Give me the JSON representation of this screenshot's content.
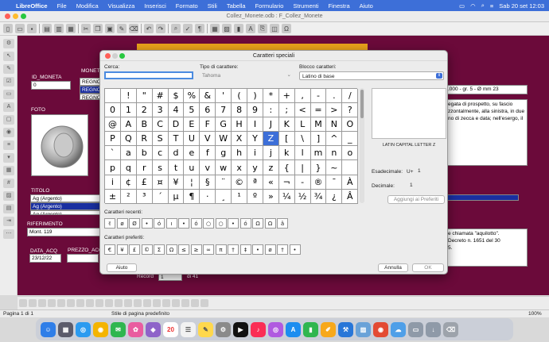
{
  "menubar": {
    "app": "LibreOffice",
    "items": [
      "File",
      "Modifica",
      "Visualizza",
      "Inserisci",
      "Formato",
      "Stili",
      "Tabella",
      "Formulario",
      "Strumenti",
      "Finestra",
      "Aiuto"
    ],
    "clock": "Sab 20 set  12:03"
  },
  "window": {
    "title": "Collez_Monete.odb : F_Collez_Monete"
  },
  "form": {
    "id_label": "ID_MONETA",
    "id_value": "0",
    "moneta_label": "MONETA",
    "moneta_items": [
      "REGNO",
      "REGNO",
      "REGNO"
    ],
    "desc_value": ".000 - gr. 5 - Ø mm 23",
    "text1": "egata di prospetto, su fascio\nzzontalmente, alla sinistra, in due\nno di zecca e data; nell'esergo, il",
    "foto_label": "FOTO",
    "titolo_label": "TITOLO",
    "titolo_items": [
      "Ag (Argento)",
      "Ag (Argento)",
      "Ag (Argento)"
    ],
    "rif_label": "RIFERIMENTO",
    "rif_value": "Mont. 119",
    "data_label": "DATA_ACQ",
    "data_value": "23/12/22",
    "prezzo_label": "PREZZO_ACQ",
    "text2": "e chiamata \"aquilotto\".\nDecreto n. 1651 del 30\n5.",
    "record_label": "Record",
    "record_value": "1",
    "record_of": "di 41"
  },
  "dialog": {
    "title": "Caratteri speciali",
    "search_label": "Cerca:",
    "search_value": "",
    "font_label": "Tipo di carattere:",
    "font_value": "Tahoma",
    "block_label": "Blocco caratteri:",
    "block_value": "Latino di base",
    "chars": [
      " ",
      "!",
      "\"",
      "#",
      "$",
      "%",
      "&",
      "'",
      "(",
      ")",
      "*",
      "+",
      ",",
      "-",
      ".",
      "/",
      "0",
      "1",
      "2",
      "3",
      "4",
      "5",
      "6",
      "7",
      "8",
      "9",
      ":",
      ";",
      "<",
      "=",
      ">",
      "?",
      "@",
      "A",
      "B",
      "C",
      "D",
      "E",
      "F",
      "G",
      "H",
      "I",
      "J",
      "K",
      "L",
      "M",
      "N",
      "O",
      "P",
      "Q",
      "R",
      "S",
      "T",
      "U",
      "V",
      "W",
      "X",
      "Y",
      "Z",
      "[",
      "\\",
      "]",
      "^",
      "_",
      "`",
      "a",
      "b",
      "c",
      "d",
      "e",
      "f",
      "g",
      "h",
      "i",
      "j",
      "k",
      "l",
      "m",
      "n",
      "o",
      "p",
      "q",
      "r",
      "s",
      "t",
      "u",
      "v",
      "w",
      "x",
      "y",
      "z",
      "{",
      "|",
      "}",
      "~",
      " ",
      "i",
      "¢",
      "£",
      "¤",
      "¥",
      "¦",
      "§",
      "¨",
      "©",
      "ª",
      "«",
      "¬",
      "-",
      "®",
      "¯",
      "À",
      "±",
      "²",
      "³",
      "´",
      "µ",
      "¶",
      "·",
      "¸",
      "¹",
      "º",
      "»",
      "¼",
      "½",
      "¾",
      "¿",
      "Â"
    ],
    "selected_index": 58,
    "char_name": "LATIN CAPITAL LETTER Z",
    "hex_label": "Esadecimale:",
    "hex_prefix": "U+",
    "hex_value": "1",
    "dec_label": "Decimale:",
    "dec_value": "1",
    "add_fav": "Aggiungi ai Preferiti",
    "recent_label": "Caratteri recenti:",
    "recent": [
      "✌",
      "ø",
      "Ø",
      "•",
      "ó",
      "ı",
      "•",
      "ó",
      "○",
      "○",
      "•",
      "ó",
      "Ω",
      "Ω",
      "â"
    ],
    "fav_label": "Caratteri preferiti:",
    "fav": [
      "€",
      "¥",
      "£",
      "©",
      "Σ",
      "Ω",
      "≤",
      "≥",
      "∞",
      "π",
      "†",
      "‡",
      "•",
      "ø",
      "†",
      "•"
    ],
    "help": "Aiuto",
    "cancel": "Annulla",
    "ok": "OK"
  },
  "status": {
    "page": "Pagina 1 di 1",
    "style": "Stile di pagina predefinito",
    "zoom": "100%"
  },
  "dock_date": "20"
}
